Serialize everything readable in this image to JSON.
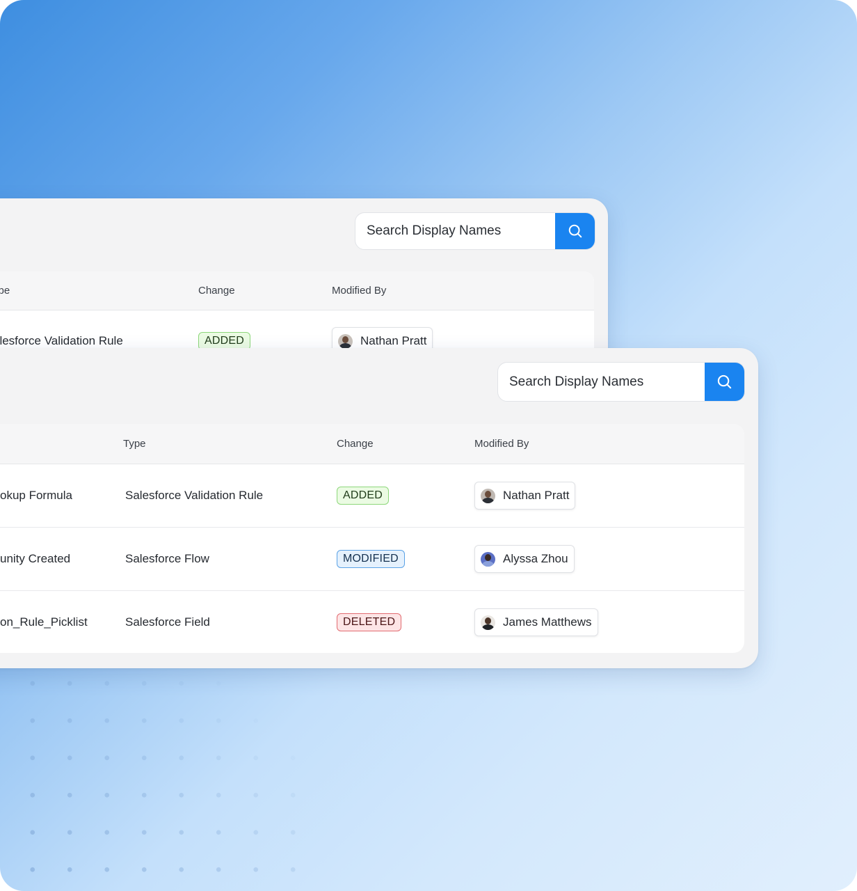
{
  "search": {
    "placeholder": "Search Display Names"
  },
  "back_table": {
    "columns": {
      "type": "ype",
      "change": "Change",
      "modified_by": "Modified By"
    },
    "rows": [
      {
        "type": "alesforce Validation Rule",
        "change": "ADDED",
        "modified_by": "Nathan Pratt"
      }
    ]
  },
  "front_table": {
    "columns": {
      "type": "Type",
      "change": "Change",
      "modified_by": "Modified By"
    },
    "rows": [
      {
        "name": "okup Formula",
        "type": "Salesforce Validation Rule",
        "change": "ADDED",
        "modified_by": "Nathan Pratt"
      },
      {
        "name": "unity Created",
        "type": "Salesforce Flow",
        "change": "MODIFIED",
        "modified_by": "Alyssa Zhou"
      },
      {
        "name": "on_Rule_Picklist",
        "type": "Salesforce Field",
        "change": "DELETED",
        "modified_by": "James Matthews"
      }
    ]
  },
  "colors": {
    "accent": "#1a84f0",
    "added": "#8dd77a",
    "modified": "#5aa2e6",
    "deleted": "#e26b70"
  },
  "icons": {
    "search_button": "search-icon"
  }
}
